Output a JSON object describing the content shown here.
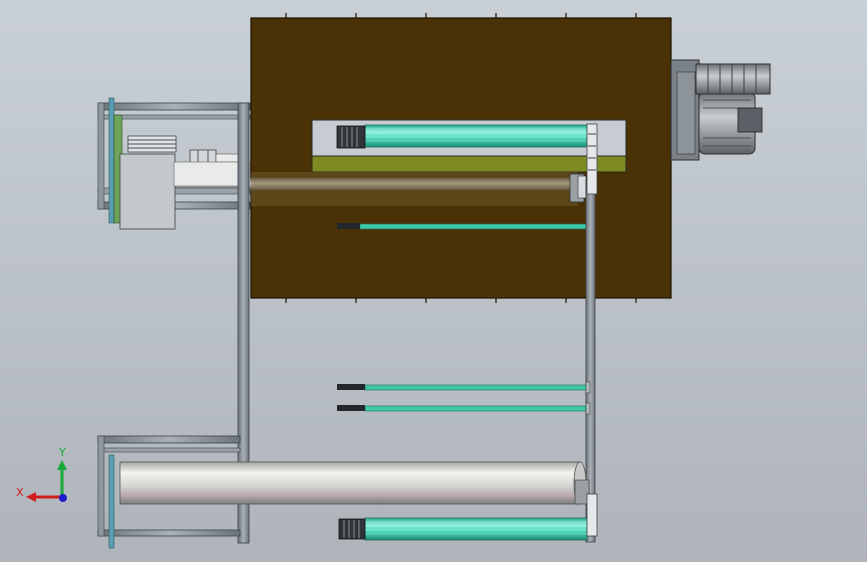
{
  "viewport": {
    "background_top": "#c9d0d6",
    "background_bottom": "#aeb4ba"
  },
  "model": {
    "enclosure_color": "#4a3206",
    "window_color": "#c6ccd1",
    "rail_color": "#7e8a24",
    "frame_color": "#8f979e",
    "roller_color": "#d9dcd8",
    "brush_color": "#4fd9bd",
    "motor_color": "#9aa1a6"
  },
  "triad": {
    "x_label": "X",
    "y_label": "Y",
    "x_color": "#d01e1e",
    "y_color": "#1ba83a",
    "z_color": "#1c1ccc"
  }
}
